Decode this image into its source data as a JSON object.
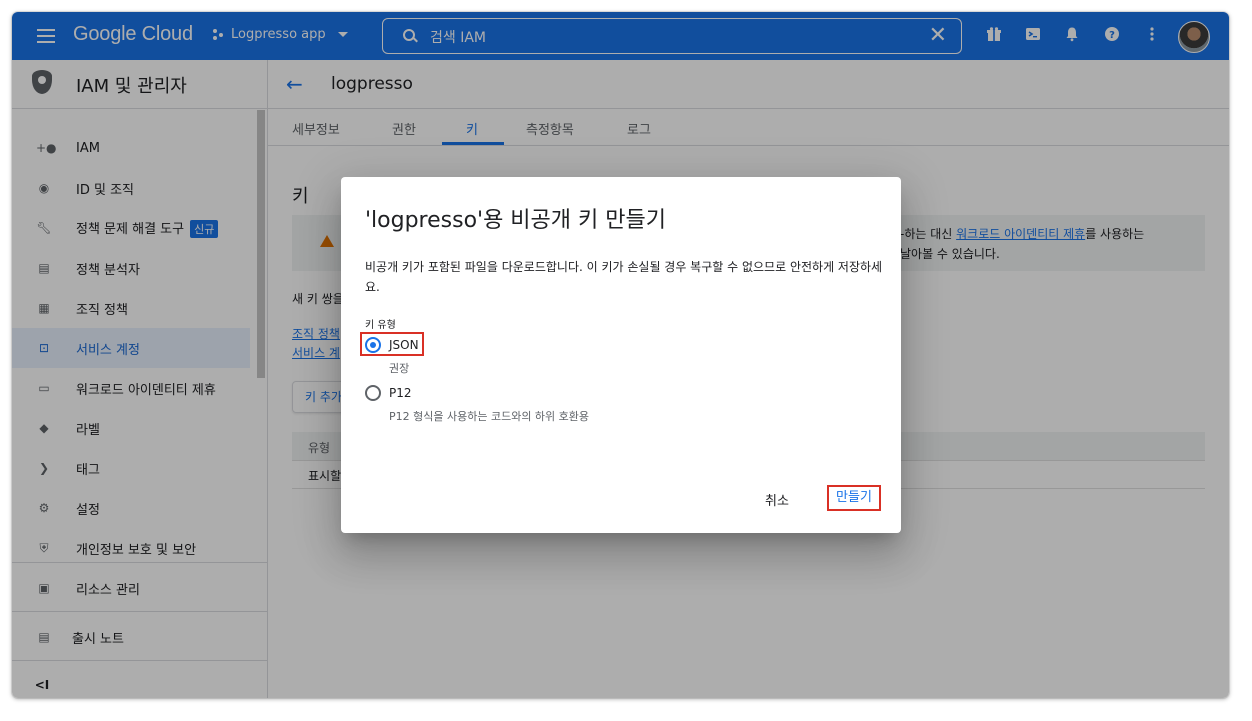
{
  "topbar": {
    "logo": "Google Cloud",
    "project": "Logpresso app",
    "search_text": "검색  IAM",
    "icons": [
      "menu-icon",
      "search-icon",
      "close-icon",
      "gift-icon",
      "terminal-icon",
      "bell-icon",
      "help-icon",
      "more-vert-icon"
    ],
    "accent": "#1a73e8"
  },
  "sidebar": {
    "title": "IAM 및 관리자",
    "items": [
      {
        "label": "IAM",
        "icon": "person-add-icon"
      },
      {
        "label": "ID 및 조직",
        "icon": "account-circle-icon"
      },
      {
        "label": "정책 문제 해결 도구",
        "icon": "wrench-icon",
        "badge": "신규"
      },
      {
        "label": "정책 분석자",
        "icon": "document-search-icon"
      },
      {
        "label": "조직 정책",
        "icon": "list-box-icon"
      },
      {
        "label": "서비스 계정",
        "icon": "service-account-icon",
        "active": true
      },
      {
        "label": "워크로드 아이덴티티 제휴",
        "icon": "id-card-icon"
      },
      {
        "label": "라벨",
        "icon": "label-icon"
      },
      {
        "label": "태그",
        "icon": "tag-chevron-icon"
      },
      {
        "label": "설정",
        "icon": "gear-icon"
      },
      {
        "label": "개인정보 보호 및 보안",
        "icon": "shield-icon"
      },
      {
        "label": "리소스 관리",
        "icon": "folder-gear-icon"
      }
    ],
    "release_notes": "출시 노트",
    "collapse": "<I"
  },
  "main": {
    "title": "logpresso",
    "tabs": [
      "세부정보",
      "권한",
      "키",
      "측정항목",
      "로그"
    ],
    "active_tab": "키",
    "section_title": "키",
    "warning_text_1a": "-하는 대신 ",
    "warning_link": "워크로드 아이덴티티 제휴",
    "warning_text_1b": "를 사용하는",
    "warning_text_2": "날아볼 수 있습니다.",
    "new_keypair_text": "새 키 쌍을",
    "link_org_policy": "조직 정책",
    "link_service": "서비스 계",
    "add_key": "키 추가",
    "table_header": "유형",
    "table_row": "표시할"
  },
  "dialog": {
    "title": "'logpresso'용 비공개 키 만들기",
    "description": "비공개 키가 포함된 파일을 다운로드합니다. 이 키가 손실될 경우 복구할 수 없으므로 안전하게 저장하세요.",
    "key_type_label": "키 유형",
    "options": [
      {
        "label": "JSON",
        "sub": "권장",
        "selected": true
      },
      {
        "label": "P12",
        "sub": "P12 형식을 사용하는 코드와의 하위 호환용",
        "selected": false
      }
    ],
    "cancel": "취소",
    "create": "만들기",
    "highlight_color": "#d93025"
  }
}
